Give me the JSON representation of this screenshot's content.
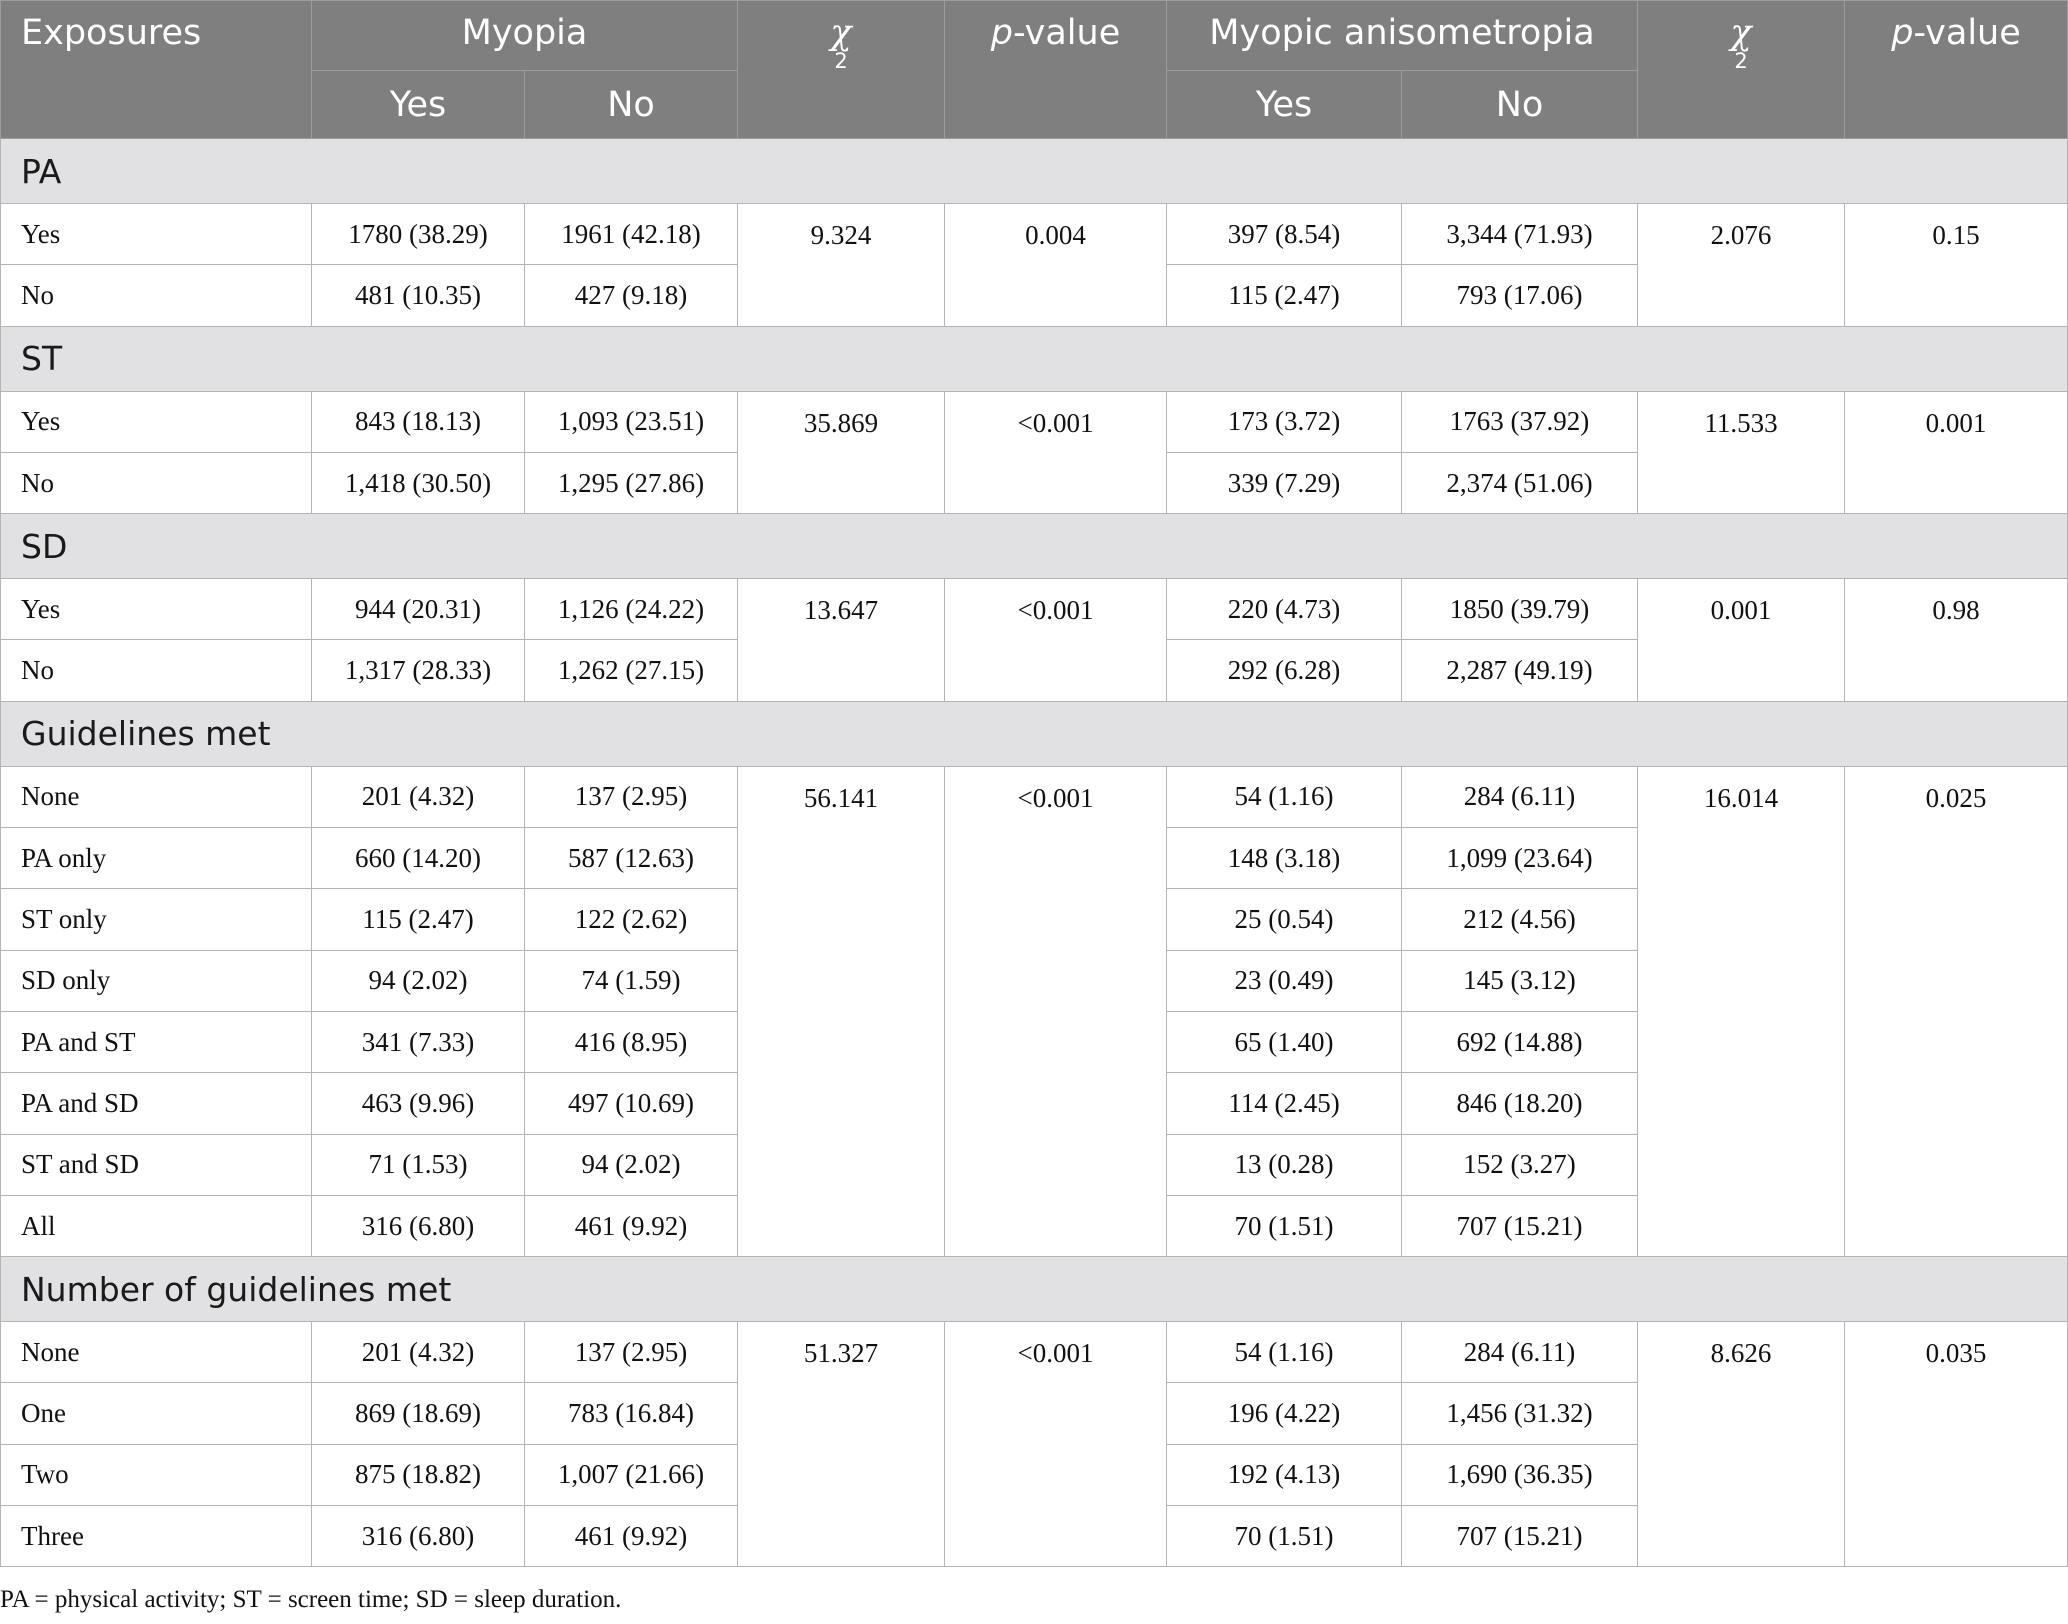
{
  "header": {
    "exposures": "Exposures",
    "myopia": "Myopia",
    "chi_symbol": "χ",
    "chi_sub": "2",
    "p_italic": "p",
    "p_rest": "-value",
    "anisometropia": "Myopic anisometropia",
    "yes": "Yes",
    "no": "No"
  },
  "sections": [
    {
      "title": "PA",
      "rows": [
        {
          "label": "Yes",
          "my_yes": "1780 (38.29)",
          "my_no": "1961 (42.18)",
          "chi1": "9.324",
          "p1": "0.004",
          "an_yes": "397 (8.54)",
          "an_no": "3,344 (71.93)",
          "chi2": "2.076",
          "p2": "0.15"
        },
        {
          "label": "No",
          "my_yes": "481 (10.35)",
          "my_no": "427 (9.18)",
          "an_yes": "115 (2.47)",
          "an_no": "793 (17.06)"
        }
      ]
    },
    {
      "title": "ST",
      "rows": [
        {
          "label": "Yes",
          "my_yes": "843 (18.13)",
          "my_no": "1,093 (23.51)",
          "chi1": "35.869",
          "p1": "<0.001",
          "an_yes": "173 (3.72)",
          "an_no": "1763 (37.92)",
          "chi2": "11.533",
          "p2": "0.001"
        },
        {
          "label": "No",
          "my_yes": "1,418 (30.50)",
          "my_no": "1,295 (27.86)",
          "an_yes": "339 (7.29)",
          "an_no": "2,374 (51.06)"
        }
      ]
    },
    {
      "title": "SD",
      "rows": [
        {
          "label": "Yes",
          "my_yes": "944 (20.31)",
          "my_no": "1,126 (24.22)",
          "chi1": "13.647",
          "p1": "<0.001",
          "an_yes": "220 (4.73)",
          "an_no": "1850 (39.79)",
          "chi2": "0.001",
          "p2": "0.98"
        },
        {
          "label": "No",
          "my_yes": "1,317 (28.33)",
          "my_no": "1,262 (27.15)",
          "an_yes": "292 (6.28)",
          "an_no": "2,287 (49.19)"
        }
      ]
    },
    {
      "title": "Guidelines met",
      "rows": [
        {
          "label": "None",
          "my_yes": "201 (4.32)",
          "my_no": "137 (2.95)",
          "chi1": "56.141",
          "p1": "<0.001",
          "an_yes": "54 (1.16)",
          "an_no": "284 (6.11)",
          "chi2": "16.014",
          "p2": "0.025"
        },
        {
          "label": "PA only",
          "my_yes": "660 (14.20)",
          "my_no": "587 (12.63)",
          "an_yes": "148 (3.18)",
          "an_no": "1,099 (23.64)"
        },
        {
          "label": "ST only",
          "my_yes": "115 (2.47)",
          "my_no": "122 (2.62)",
          "an_yes": "25 (0.54)",
          "an_no": "212 (4.56)"
        },
        {
          "label": "SD only",
          "my_yes": "94 (2.02)",
          "my_no": "74 (1.59)",
          "an_yes": "23 (0.49)",
          "an_no": "145 (3.12)"
        },
        {
          "label": "PA and ST",
          "my_yes": "341 (7.33)",
          "my_no": "416 (8.95)",
          "an_yes": "65 (1.40)",
          "an_no": "692 (14.88)"
        },
        {
          "label": "PA and SD",
          "my_yes": "463 (9.96)",
          "my_no": "497 (10.69)",
          "an_yes": "114 (2.45)",
          "an_no": "846 (18.20)"
        },
        {
          "label": "ST and SD",
          "my_yes": "71 (1.53)",
          "my_no": "94 (2.02)",
          "an_yes": "13 (0.28)",
          "an_no": "152 (3.27)"
        },
        {
          "label": "All",
          "my_yes": "316 (6.80)",
          "my_no": "461 (9.92)",
          "an_yes": "70 (1.51)",
          "an_no": "707 (15.21)"
        }
      ]
    },
    {
      "title": "Number of guidelines met",
      "rows": [
        {
          "label": "None",
          "my_yes": "201 (4.32)",
          "my_no": "137 (2.95)",
          "chi1": "51.327",
          "p1": "<0.001",
          "an_yes": "54 (1.16)",
          "an_no": "284 (6.11)",
          "chi2": "8.626",
          "p2": "0.035"
        },
        {
          "label": "One",
          "my_yes": "869 (18.69)",
          "my_no": "783 (16.84)",
          "an_yes": "196 (4.22)",
          "an_no": "1,456 (31.32)"
        },
        {
          "label": "Two",
          "my_yes": "875 (18.82)",
          "my_no": "1,007 (21.66)",
          "an_yes": "192 (4.13)",
          "an_no": "1,690 (36.35)"
        },
        {
          "label": "Three",
          "my_yes": "316 (6.80)",
          "my_no": "461 (9.92)",
          "an_yes": "70 (1.51)",
          "an_no": "707 (15.21)"
        }
      ]
    }
  ],
  "footnote": "PA = physical activity; ST = screen time; SD = sleep duration."
}
